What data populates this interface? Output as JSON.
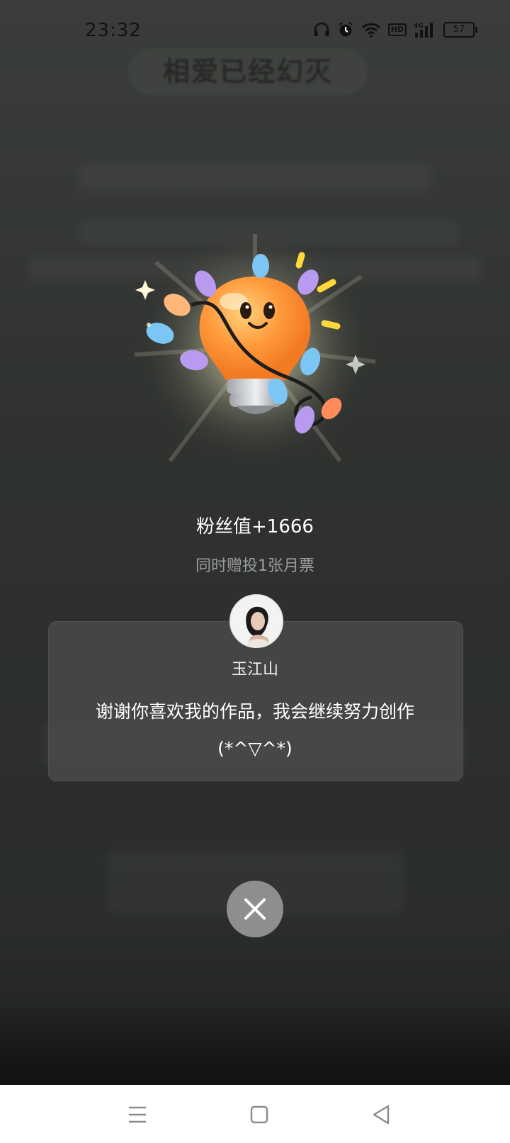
{
  "status_bar": {
    "time": "23:32",
    "battery_level": "57",
    "network": "4G",
    "hd_badge": "HD",
    "icons": [
      "headphones-icon",
      "alarm-icon",
      "wifi-icon",
      "hd-icon",
      "cellular-signal-icon",
      "battery-icon"
    ]
  },
  "background": {
    "title": "相爱已经幻灭"
  },
  "reward": {
    "icon": "lightbulb-mascot-icon",
    "fan_value": "粉丝值+1666",
    "subtitle": "同时赠投1张月票"
  },
  "message_card": {
    "author": "玉江山",
    "text": "谢谢你喜欢我的作品，我会继续努力创作(*^▽^*)"
  },
  "close_button": {
    "icon": "close-icon"
  },
  "nav_bar": {
    "icons": [
      "menu-icon",
      "home-square-icon",
      "back-triangle-icon"
    ]
  },
  "colors": {
    "overlay": "#2c2f2d",
    "card": "#4a4d4a",
    "close_button": "#8e8f8d",
    "bulb": "#ff9a3c"
  }
}
